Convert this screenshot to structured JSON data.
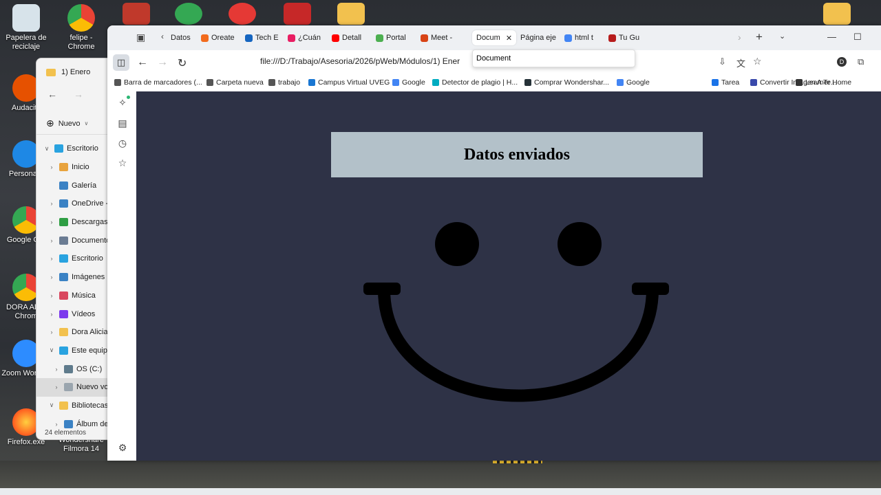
{
  "desktop": {
    "icons": [
      {
        "label": "Papelera de reciclaje"
      },
      {
        "label": "felipe - Chrome"
      },
      {
        "label": "Audacity"
      },
      {
        "label": "Personal -"
      },
      {
        "label": "Google Chr"
      },
      {
        "label": "DORA ALIC Chrom"
      },
      {
        "label": "Zoom Workpla"
      },
      {
        "label": "Firefox.exe"
      },
      {
        "label": "Wondershare Filmora 14"
      }
    ]
  },
  "explorer": {
    "title": "1) Enero",
    "new_label": "Nuevo",
    "tree": [
      {
        "label": "Escritorio",
        "chev": "v",
        "indent": 0
      },
      {
        "label": "Inicio",
        "chev": ">",
        "indent": 1
      },
      {
        "label": "Galería",
        "chev": "",
        "indent": 1
      },
      {
        "label": "OneDrive -",
        "chev": ">",
        "indent": 1
      },
      {
        "label": "Descargas",
        "chev": ">",
        "indent": 1
      },
      {
        "label": "Documento",
        "chev": ">",
        "indent": 1
      },
      {
        "label": "Escritorio",
        "chev": ">",
        "indent": 1
      },
      {
        "label": "Imágenes",
        "chev": ">",
        "indent": 1
      },
      {
        "label": "Música",
        "chev": ">",
        "indent": 1
      },
      {
        "label": "Vídeos",
        "chev": ">",
        "indent": 1
      },
      {
        "label": "Dora Alicia",
        "chev": ">",
        "indent": 1
      },
      {
        "label": "Este equipo",
        "chev": "v",
        "indent": 1
      },
      {
        "label": "OS (C:)",
        "chev": ">",
        "indent": 2
      },
      {
        "label": "Nuevo vol",
        "chev": ">",
        "indent": 2
      },
      {
        "label": "Bibliotecas",
        "chev": "v",
        "indent": 1
      },
      {
        "label": "Álbum de",
        "chev": ">",
        "indent": 2
      }
    ],
    "status": "24 elementos"
  },
  "browser": {
    "tabs": [
      {
        "label": "Datos",
        "color": "#ffffff"
      },
      {
        "label": "Oreate",
        "color": "#f26b1d"
      },
      {
        "label": "Tech E",
        "color": "#1565c0"
      },
      {
        "label": "¿Cuán",
        "color": "#e91e63"
      },
      {
        "label": "Detall",
        "color": "#ff0000"
      },
      {
        "label": "Portal",
        "color": "#4caf50"
      },
      {
        "label": "Meet -",
        "color": "#d84315"
      },
      {
        "label": "Docum",
        "color": "#ffffff"
      },
      {
        "label": "Página eje",
        "color": "#ffffff"
      },
      {
        "label": "html t",
        "color": "#4285f4"
      },
      {
        "label": "Tu Gu",
        "color": "#b71c1c"
      }
    ],
    "tooltip": "Document",
    "url": "file:///D:/Trabajo/Asesoria/2026/pWeb/Módulos/1) Ener",
    "profile_initial": "D",
    "bookmarks": [
      {
        "label": "Barra de marcadores (...",
        "color": "#555555"
      },
      {
        "label": "Carpeta nueva",
        "color": "#555555"
      },
      {
        "label": "trabajo",
        "color": "#555555"
      },
      {
        "label": "Campus Virtual UVEG",
        "color": "#1976d2"
      },
      {
        "label": "Google",
        "color": "#4285f4"
      },
      {
        "label": "Detector de plagio | H...",
        "color": "#00acc1"
      },
      {
        "label": "Comprar Wondershar...",
        "color": "#263238"
      },
      {
        "label": "Google",
        "color": "#4285f4"
      },
      {
        "label": "Tarea",
        "color": "#1a73e8"
      },
      {
        "label": "Convertir Imagen A Te...",
        "color": "#3949ab"
      },
      {
        "label": "Learner Home",
        "color": "#333333"
      }
    ]
  },
  "page": {
    "heading": "Datos enviados",
    "background": "#2e3246",
    "banner_color": "#b3c1c9"
  }
}
